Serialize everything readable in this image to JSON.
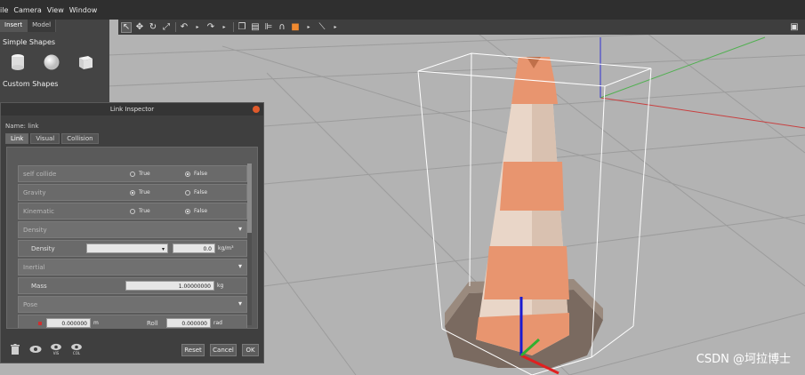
{
  "menu": [
    "ile",
    "Camera",
    "View",
    "Window"
  ],
  "toolbar": {
    "icons": [
      "select-arrow-icon",
      "translate-icon",
      "rotate-icon",
      "scale-icon",
      "undo-icon",
      "redo-icon",
      "copy-icon",
      "paste-icon",
      "align-icon",
      "snap-icon",
      "orange-shape-icon",
      "measure-icon",
      "camera-icon"
    ]
  },
  "insert_panel": {
    "tabs": [
      "Insert",
      "Model"
    ],
    "active_tab": "Insert",
    "simple_shapes_title": "Simple Shapes",
    "custom_shapes_title": "Custom Shapes"
  },
  "inspector": {
    "title": "Link Inspector",
    "name_line": "Name: link",
    "tabs": [
      "Link",
      "Visual",
      "Collision"
    ],
    "active_tab": "Link",
    "rows": {
      "self_collide": {
        "label": "self collide",
        "opt_true": "True",
        "opt_false": "False",
        "selected": "False"
      },
      "gravity": {
        "label": "Gravity",
        "opt_true": "True",
        "opt_false": "False",
        "selected": "True"
      },
      "kinematic": {
        "label": "Kinematic",
        "opt_true": "True",
        "opt_false": "False",
        "selected": "False"
      },
      "density_section": "Density",
      "density": {
        "label": "Density",
        "value": "0.0",
        "unit": "kg/m³"
      },
      "inertial_section": "Inertial",
      "mass": {
        "label": "Mass",
        "value": "1.00000000",
        "unit": "kg"
      },
      "pose_section": "Pose",
      "pose_x": {
        "value": "0.000000",
        "unit": "m"
      },
      "roll": {
        "label": "Roll",
        "value": "0.000000",
        "unit": "rad"
      }
    },
    "footer": {
      "reset": "Reset",
      "cancel": "Cancel",
      "ok": "OK",
      "vis_label": "VIS",
      "col_label": "COL"
    }
  },
  "watermark": "CSDN @坷拉博士",
  "colors": {
    "viewport_bg": "#b3b3b3",
    "cone_orange": "#e8956f",
    "cone_white": "#e9d6c8",
    "axis_red": "#e02020",
    "axis_green": "#30b030",
    "axis_blue": "#1a1ad0"
  }
}
